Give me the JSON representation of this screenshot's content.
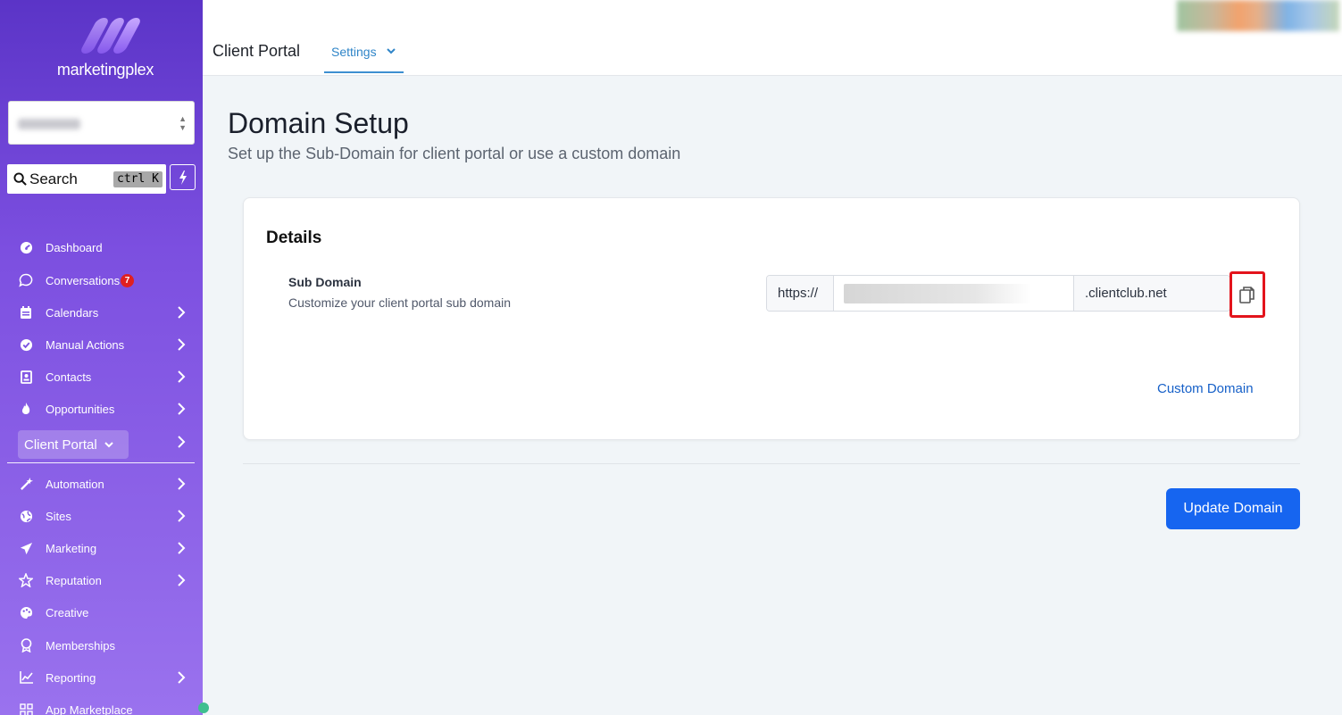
{
  "brand": {
    "name": "marketingplex"
  },
  "sidebar": {
    "search": {
      "placeholder": "Search",
      "shortcut": "ctrl K"
    },
    "items": [
      {
        "label": "Dashboard",
        "icon": "gauge-icon"
      },
      {
        "label": "Conversations",
        "icon": "chat-bubble-icon",
        "badge": "7"
      },
      {
        "label": "Calendars",
        "icon": "calendar-icon"
      },
      {
        "label": "Manual Actions",
        "icon": "check-circle-icon"
      },
      {
        "label": "Contacts",
        "icon": "contact-card-icon"
      },
      {
        "label": "Opportunities",
        "icon": "flame-icon"
      },
      {
        "label": "Client Portal",
        "icon": "chevron-down-icon"
      },
      {
        "label": "Automation",
        "icon": "magic-wand-icon"
      },
      {
        "label": "Sites",
        "icon": "globe-icon"
      },
      {
        "label": "Marketing",
        "icon": "paper-plane-icon"
      },
      {
        "label": "Reputation",
        "icon": "star-icon"
      },
      {
        "label": "Creative",
        "icon": "palette-icon"
      },
      {
        "label": "Memberships",
        "icon": "award-icon"
      },
      {
        "label": "Reporting",
        "icon": "chart-line-icon"
      },
      {
        "label": "App Marketplace",
        "icon": "grid-icon"
      }
    ]
  },
  "header": {
    "title": "Client Portal",
    "tab_label": "Settings"
  },
  "main": {
    "title": "Domain Setup",
    "subtitle": "Set up the Sub-Domain for client portal or use a custom domain",
    "card": {
      "title": "Details",
      "field_label": "Sub Domain",
      "field_description": "Customize your client portal sub domain",
      "prefix": "https://",
      "suffix": ".clientclub.net",
      "custom_domain_link": "Custom Domain"
    },
    "update_button": "Update Domain"
  },
  "colors": {
    "accent_blue": "#1665f0",
    "link_blue": "#1660c8",
    "tab_blue": "#2f85c8",
    "highlight_red": "#e3141c",
    "sidebar_top": "#5b34c7",
    "sidebar_bottom": "#9a72ee"
  }
}
